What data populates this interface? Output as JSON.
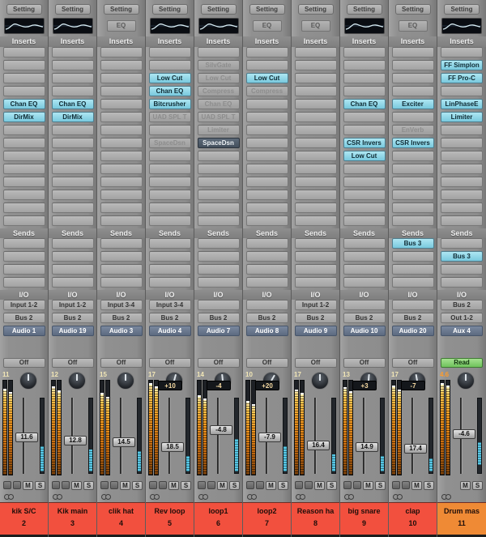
{
  "labels": {
    "setting": "Setting",
    "inserts": "Inserts",
    "sends": "Sends",
    "io": "I/O",
    "eq": "EQ",
    "mute": "M",
    "solo": "S"
  },
  "colors": {
    "active_plugin": "#79c9de",
    "disabled_plugin_text": "#8d8d8d",
    "selected_plugin": "#434f5c",
    "track_label": "#5c6a80",
    "read_button": "#6fc25c",
    "meter_hot": "#f0961d",
    "meter_level": "#56c8e6",
    "name_red": "#f2503e",
    "name_orange": "#ef8a35"
  },
  "layout": {
    "insert_slots": 14,
    "send_slots": 4
  },
  "strips": [
    {
      "eq_display": "curve",
      "inserts": [
        {
          "row": 4,
          "label": "Chan EQ",
          "state": "active"
        },
        {
          "row": 5,
          "label": "DirMix",
          "state": "active"
        }
      ],
      "sends": [],
      "input": "Input 1-2",
      "output": "Bus 2",
      "track": "Audio 1",
      "automation": "Off",
      "pan": null,
      "peak": {
        "value": "11",
        "hot": false
      },
      "fader": {
        "value": "11.6",
        "pos_pct": 52
      },
      "cyan": {
        "top_pct": 64,
        "h_pct": 34
      },
      "meters": {
        "l": 90,
        "r": 86
      },
      "show_rec": true,
      "name": "kik S/C",
      "number": "2",
      "name_color": "#f2503e"
    },
    {
      "eq_display": "curve",
      "inserts": [
        {
          "row": 4,
          "label": "Chan EQ",
          "state": "active"
        },
        {
          "row": 5,
          "label": "DirMix",
          "state": "active"
        }
      ],
      "sends": [],
      "input": "Input 1-2",
      "output": "Bus 2",
      "track": "Audio 19",
      "automation": "Off",
      "pan": null,
      "peak": {
        "value": "12",
        "hot": false
      },
      "fader": {
        "value": "12.8",
        "pos_pct": 57
      },
      "cyan": {
        "top_pct": 68,
        "h_pct": 30
      },
      "meters": {
        "l": 92,
        "r": 88
      },
      "show_rec": true,
      "name": "Kik main",
      "number": "3",
      "name_color": "#f2503e"
    },
    {
      "eq_display": "label",
      "inserts": [],
      "sends": [],
      "input": "Input 3-4",
      "output": "Bus 2",
      "track": "Audio 3",
      "automation": "Off",
      "pan": null,
      "peak": {
        "value": "15",
        "hot": false
      },
      "fader": {
        "value": "14.5",
        "pos_pct": 60
      },
      "cyan": {
        "top_pct": 71,
        "h_pct": 27
      },
      "meters": {
        "l": 85,
        "r": 81
      },
      "show_rec": true,
      "name": "clik hat",
      "number": "4",
      "name_color": "#f2503e"
    },
    {
      "eq_display": "curve",
      "inserts": [
        {
          "row": 2,
          "label": "Low Cut",
          "state": "active"
        },
        {
          "row": 3,
          "label": "Chan EQ",
          "state": "active"
        },
        {
          "row": 4,
          "label": "Bitcrusher",
          "state": "active"
        },
        {
          "row": 5,
          "label": "UAD SPL T",
          "state": "disabled"
        },
        {
          "row": 7,
          "label": "SpaceDsn",
          "state": "disabled"
        }
      ],
      "sends": [],
      "input": "Input 3-4",
      "output": "Bus 2",
      "track": "Audio 4",
      "automation": "Off",
      "pan": "+10",
      "peak": {
        "value": "17",
        "hot": false
      },
      "fader": {
        "value": "18.5",
        "pos_pct": 67
      },
      "cyan": {
        "top_pct": 77,
        "h_pct": 21
      },
      "meters": {
        "l": 96,
        "r": 92
      },
      "show_rec": true,
      "name": "Rev loop",
      "number": "5",
      "name_color": "#f2503e"
    },
    {
      "eq_display": "curve",
      "inserts": [
        {
          "row": 1,
          "label": "SilvGate",
          "state": "disabled"
        },
        {
          "row": 2,
          "label": "Low Cut",
          "state": "disabled"
        },
        {
          "row": 3,
          "label": "Compress",
          "state": "disabled"
        },
        {
          "row": 4,
          "label": "Chan EQ",
          "state": "disabled"
        },
        {
          "row": 5,
          "label": "UAD SPL T",
          "state": "disabled"
        },
        {
          "row": 6,
          "label": "Limiter",
          "state": "disabled"
        },
        {
          "row": 7,
          "label": "SpaceDsn",
          "state": "selected"
        }
      ],
      "sends": [],
      "input": "",
      "output": "Bus 2",
      "track": "Audio 7",
      "automation": "Off",
      "pan": "-4",
      "peak": {
        "value": "14",
        "hot": false
      },
      "fader": {
        "value": "-4.8",
        "pos_pct": 42
      },
      "cyan": {
        "top_pct": 54,
        "h_pct": 44
      },
      "meters": {
        "l": 83,
        "r": 79
      },
      "show_rec": true,
      "name": "loop1",
      "number": "6",
      "name_color": "#f2503e"
    },
    {
      "eq_display": "label",
      "inserts": [
        {
          "row": 2,
          "label": "Low Cut",
          "state": "active"
        },
        {
          "row": 3,
          "label": "Compress",
          "state": "disabled"
        }
      ],
      "sends": [],
      "input": "",
      "output": "Bus 2",
      "track": "Audio 8",
      "automation": "Off",
      "pan": "+20",
      "peak": {
        "value": "10",
        "hot": false
      },
      "fader": {
        "value": "-7.9",
        "pos_pct": 52
      },
      "cyan": {
        "top_pct": 64,
        "h_pct": 34
      },
      "meters": {
        "l": 77,
        "r": 73
      },
      "show_rec": true,
      "name": "loop2",
      "number": "7",
      "name_color": "#f2503e"
    },
    {
      "eq_display": "label",
      "inserts": [],
      "sends": [],
      "input": "Input 1-2",
      "output": "Bus 2",
      "track": "Audio 9",
      "automation": "Off",
      "pan": null,
      "peak": {
        "value": "17",
        "hot": false
      },
      "fader": {
        "value": "16.4",
        "pos_pct": 65
      },
      "cyan": {
        "top_pct": 75,
        "h_pct": 23
      },
      "meters": {
        "l": 89,
        "r": 85
      },
      "show_rec": true,
      "name": "Reason ha",
      "number": "8",
      "name_color": "#f2503e"
    },
    {
      "eq_display": "curve",
      "inserts": [
        {
          "row": 4,
          "label": "Chan EQ",
          "state": "active"
        },
        {
          "row": 7,
          "label": "CSR Invers",
          "state": "active"
        },
        {
          "row": 8,
          "label": "Low Cut",
          "state": "active"
        }
      ],
      "sends": [],
      "input": "",
      "output": "Bus 2",
      "track": "Audio 10",
      "automation": "Off",
      "pan": "+3",
      "peak": {
        "value": "13",
        "hot": false
      },
      "fader": {
        "value": "14.9",
        "pos_pct": 67
      },
      "cyan": {
        "top_pct": 77,
        "h_pct": 21
      },
      "meters": {
        "l": 91,
        "r": 87
      },
      "show_rec": true,
      "name": "big snare",
      "number": "9",
      "name_color": "#f2503e"
    },
    {
      "eq_display": "label",
      "inserts": [
        {
          "row": 4,
          "label": "Exciter",
          "state": "active"
        },
        {
          "row": 6,
          "label": "EnVerb",
          "state": "disabled"
        },
        {
          "row": 7,
          "label": "CSR Invers",
          "state": "active"
        }
      ],
      "sends": [
        {
          "slot": 0,
          "label": "Bus 3"
        }
      ],
      "input": "",
      "output": "Bus 2",
      "track": "Audio 20",
      "automation": "Off",
      "pan": "-7",
      "peak": {
        "value": "17",
        "hot": false
      },
      "fader": {
        "value": "17.4",
        "pos_pct": 70
      },
      "cyan": {
        "top_pct": 80,
        "h_pct": 18
      },
      "meters": {
        "l": 93,
        "r": 89
      },
      "show_rec": true,
      "name": "clap",
      "number": "10",
      "name_color": "#f2503e"
    },
    {
      "eq_display": "curve",
      "inserts": [
        {
          "row": 1,
          "label": "FF Simplon",
          "state": "active"
        },
        {
          "row": 2,
          "label": "FF Pro-C",
          "state": "active"
        },
        {
          "row": 4,
          "label": "LinPhaseE",
          "state": "active"
        },
        {
          "row": 5,
          "label": "Limiter",
          "state": "active"
        }
      ],
      "sends": [
        {
          "slot": 1,
          "label": "Bus 3"
        }
      ],
      "input": "Bus 2",
      "output": "Out 1-2",
      "track": "Aux 4",
      "automation": "Read",
      "pan": null,
      "peak": {
        "value": "4.6",
        "hot": true
      },
      "fader": {
        "value": "-4.6",
        "pos_pct": 47
      },
      "cyan": {
        "top_pct": 59,
        "h_pct": 30
      },
      "meters": {
        "l": 96,
        "r": 93
      },
      "show_rec": false,
      "name": "Drum mas",
      "number": "11",
      "name_color": "#ef8a35"
    }
  ]
}
